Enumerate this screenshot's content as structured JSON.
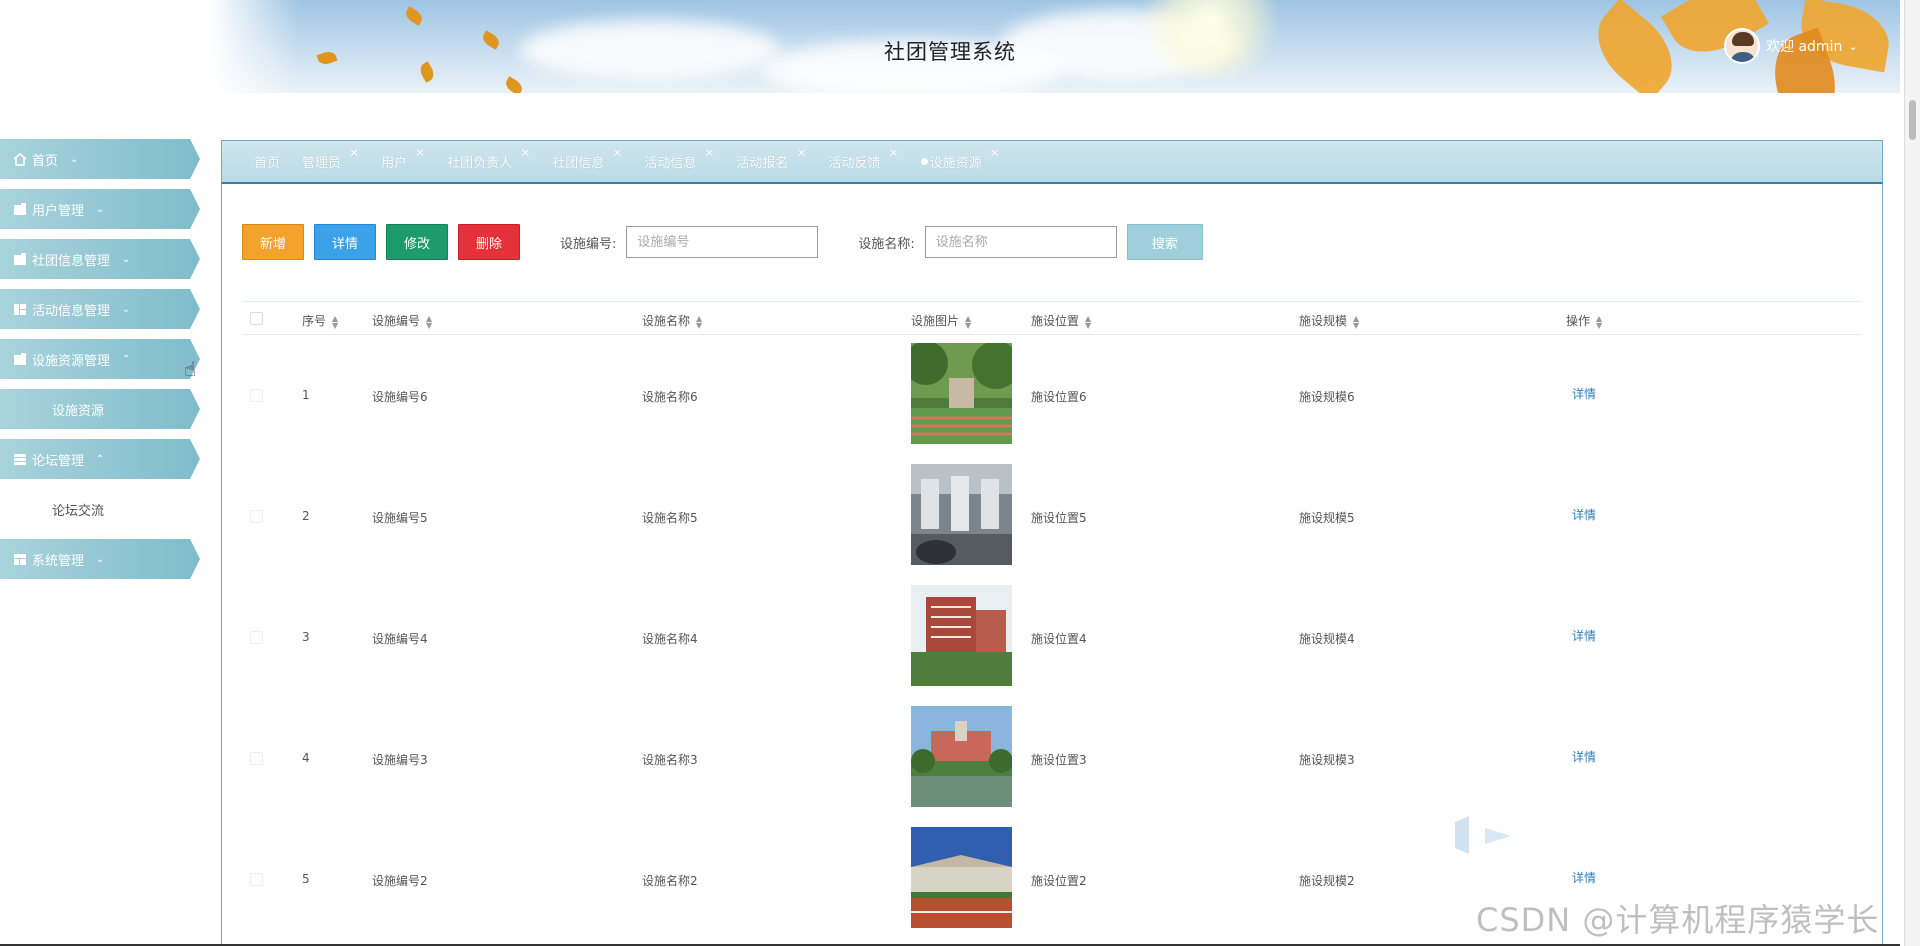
{
  "header": {
    "title": "社团管理系统",
    "welcome": "欢迎 admin"
  },
  "sidebar": {
    "items": [
      {
        "label": "首页",
        "icon": "home-icon",
        "chevron": "⌄"
      },
      {
        "label": "用户管理",
        "icon": "user-doc-icon",
        "chevron": "⌄"
      },
      {
        "label": "社团信息管理",
        "icon": "club-doc-icon",
        "chevron": "⌄"
      },
      {
        "label": "活动信息管理",
        "icon": "grid-icon",
        "chevron": "⌄"
      },
      {
        "label": "设施资源管理",
        "icon": "facility-doc-icon",
        "chevron": "⌃",
        "sub": [
          "设施资源"
        ]
      },
      {
        "label": "论坛管理",
        "icon": "list-icon",
        "chevron": "⌃",
        "sub": [
          "论坛交流"
        ]
      },
      {
        "label": "系统管理",
        "icon": "table-icon",
        "chevron": "⌄"
      }
    ]
  },
  "tabs": [
    {
      "label": "首页",
      "closable": false
    },
    {
      "label": "管理员",
      "closable": true
    },
    {
      "label": "用户",
      "closable": true
    },
    {
      "label": "社团负责人",
      "closable": true
    },
    {
      "label": "社团信息",
      "closable": true
    },
    {
      "label": "活动信息",
      "closable": true
    },
    {
      "label": "活动报名",
      "closable": true
    },
    {
      "label": "活动反馈",
      "closable": true
    },
    {
      "label": "设施资源",
      "closable": true,
      "active": true
    }
  ],
  "toolbar": {
    "add": "新增",
    "detail": "详情",
    "edit": "修改",
    "delete": "删除",
    "code_label": "设施编号:",
    "code_placeholder": "设施编号",
    "name_label": "设施名称:",
    "name_placeholder": "设施名称",
    "search": "搜索"
  },
  "table": {
    "columns": [
      "序号",
      "设施编号",
      "设施名称",
      "设施图片",
      "施设位置",
      "施设规模",
      "操作"
    ],
    "rows": [
      {
        "index": "1",
        "code": "设施编号6",
        "name": "设施名称6",
        "location": "施设位置6",
        "scale": "施设规模6",
        "action": "详情"
      },
      {
        "index": "2",
        "code": "设施编号5",
        "name": "设施名称5",
        "location": "施设位置5",
        "scale": "施设规模5",
        "action": "详情"
      },
      {
        "index": "3",
        "code": "设施编号4",
        "name": "设施名称4",
        "location": "施设位置4",
        "scale": "施设规模4",
        "action": "详情"
      },
      {
        "index": "4",
        "code": "设施编号3",
        "name": "设施名称3",
        "location": "施设位置3",
        "scale": "施设规模3",
        "action": "详情"
      },
      {
        "index": "5",
        "code": "设施编号2",
        "name": "设施名称2",
        "location": "施设位置2",
        "scale": "施设规模2",
        "action": "详情"
      }
    ]
  },
  "watermark": "CSDN @计算机程序猿学长",
  "colors": {
    "sidebar": "#7fbccb",
    "tabbar": "#b9dbe6",
    "add": "#f3a32b",
    "detail": "#3ba1e9",
    "edit": "#1e9b6c",
    "delete": "#e5323a",
    "search": "#9ecfdb",
    "link": "#2f7fb5"
  }
}
